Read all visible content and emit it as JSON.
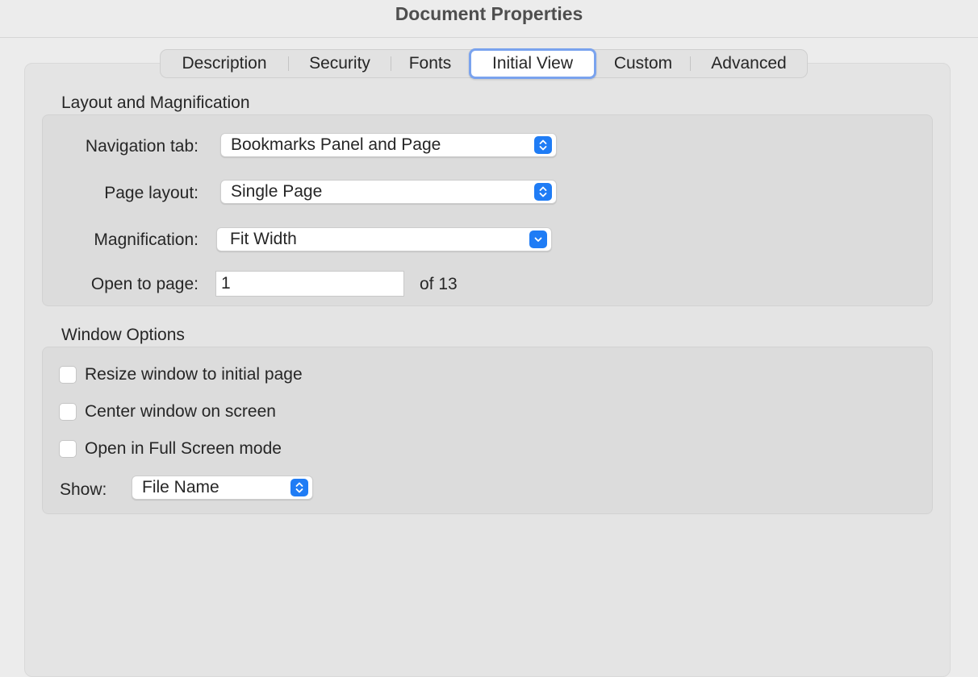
{
  "window": {
    "title": "Document Properties"
  },
  "tabs": [
    {
      "label": "Description",
      "active": false
    },
    {
      "label": "Security",
      "active": false
    },
    {
      "label": "Fonts",
      "active": false
    },
    {
      "label": "Initial View",
      "active": true
    },
    {
      "label": "Custom",
      "active": false
    },
    {
      "label": "Advanced",
      "active": false
    }
  ],
  "layout_section": {
    "title": "Layout and Magnification",
    "navigation_tab": {
      "label": "Navigation tab:",
      "value": "Bookmarks Panel and Page"
    },
    "page_layout": {
      "label": "Page layout:",
      "value": "Single Page"
    },
    "magnification": {
      "label": "Magnification:",
      "value": "Fit Width"
    },
    "open_to_page": {
      "label": "Open to page:",
      "value": "1",
      "of_text": "of 13"
    }
  },
  "window_section": {
    "title": "Window Options",
    "options": [
      {
        "label": "Resize window to initial page",
        "checked": false
      },
      {
        "label": "Center window on screen",
        "checked": false
      },
      {
        "label": "Open in Full Screen mode",
        "checked": false
      }
    ],
    "show": {
      "label": "Show:",
      "value": "File Name"
    }
  },
  "colors": {
    "accent": "#1f7cf5",
    "focus_ring": "#7aa3ee",
    "background": "#ececec"
  }
}
